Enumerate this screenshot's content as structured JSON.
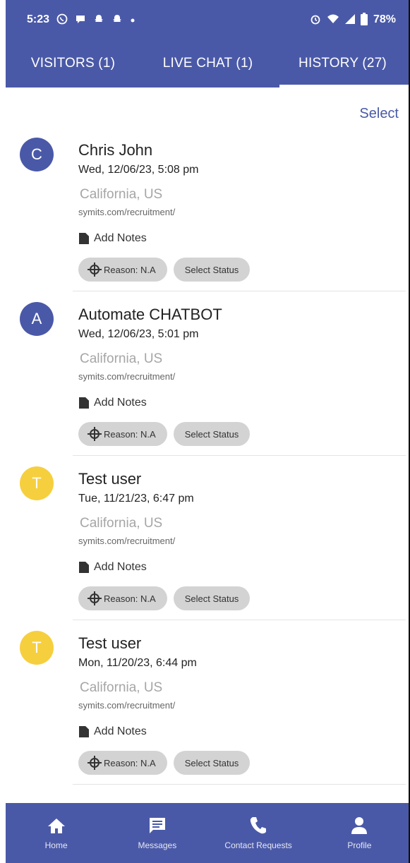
{
  "status_bar": {
    "time": "5:23",
    "battery": "78%",
    "left_icons": [
      "whatsapp-icon",
      "chat-bubble-icon",
      "snapchat-icon",
      "snapchat-icon",
      "dot-icon"
    ],
    "right_icons": [
      "alarm-icon",
      "wifi-icon",
      "signal-icon",
      "battery-icon"
    ]
  },
  "tabs": [
    {
      "label": "VISITORS (1)"
    },
    {
      "label": "LIVE CHAT (1)"
    },
    {
      "label": "HISTORY (27)",
      "active": true
    }
  ],
  "select_label": "Select",
  "history": [
    {
      "initial": "C",
      "avatar_color": "#4a59a7",
      "name": "Chris John",
      "date": "Wed, 12/06/23, 5:08 pm",
      "location": "California, US",
      "url": "symits.com/recruitment/",
      "notes_label": "Add Notes",
      "reason_label": "Reason: N.A",
      "status_label": "Select Status"
    },
    {
      "initial": "A",
      "avatar_color": "#4a59a7",
      "name": "Automate CHATBOT",
      "date": "Wed, 12/06/23, 5:01 pm",
      "location": "California, US",
      "url": "symits.com/recruitment/",
      "notes_label": "Add Notes",
      "reason_label": "Reason: N.A",
      "status_label": "Select Status"
    },
    {
      "initial": "T",
      "avatar_color": "#f6cf3e",
      "name": "Test user",
      "date": "Tue, 11/21/23, 6:47 pm",
      "location": "California, US",
      "url": "symits.com/recruitment/",
      "notes_label": "Add Notes",
      "reason_label": "Reason: N.A",
      "status_label": "Select Status"
    },
    {
      "initial": "T",
      "avatar_color": "#f6cf3e",
      "name": "Test user",
      "date": "Mon, 11/20/23, 6:44 pm",
      "location": "California, US",
      "url": "symits.com/recruitment/",
      "notes_label": "Add Notes",
      "reason_label": "Reason: N.A",
      "status_label": "Select Status"
    }
  ],
  "bottom_nav": [
    {
      "label": "Home",
      "icon": "home-icon"
    },
    {
      "label": "Messages",
      "icon": "messages-icon"
    },
    {
      "label": "Contact Requests",
      "icon": "phone-icon"
    },
    {
      "label": "Profile",
      "icon": "profile-icon"
    }
  ],
  "colors": {
    "primary": "#4a59a7",
    "yellow_avatar": "#f6cf3e",
    "chip_bg": "#d3d3d3"
  }
}
